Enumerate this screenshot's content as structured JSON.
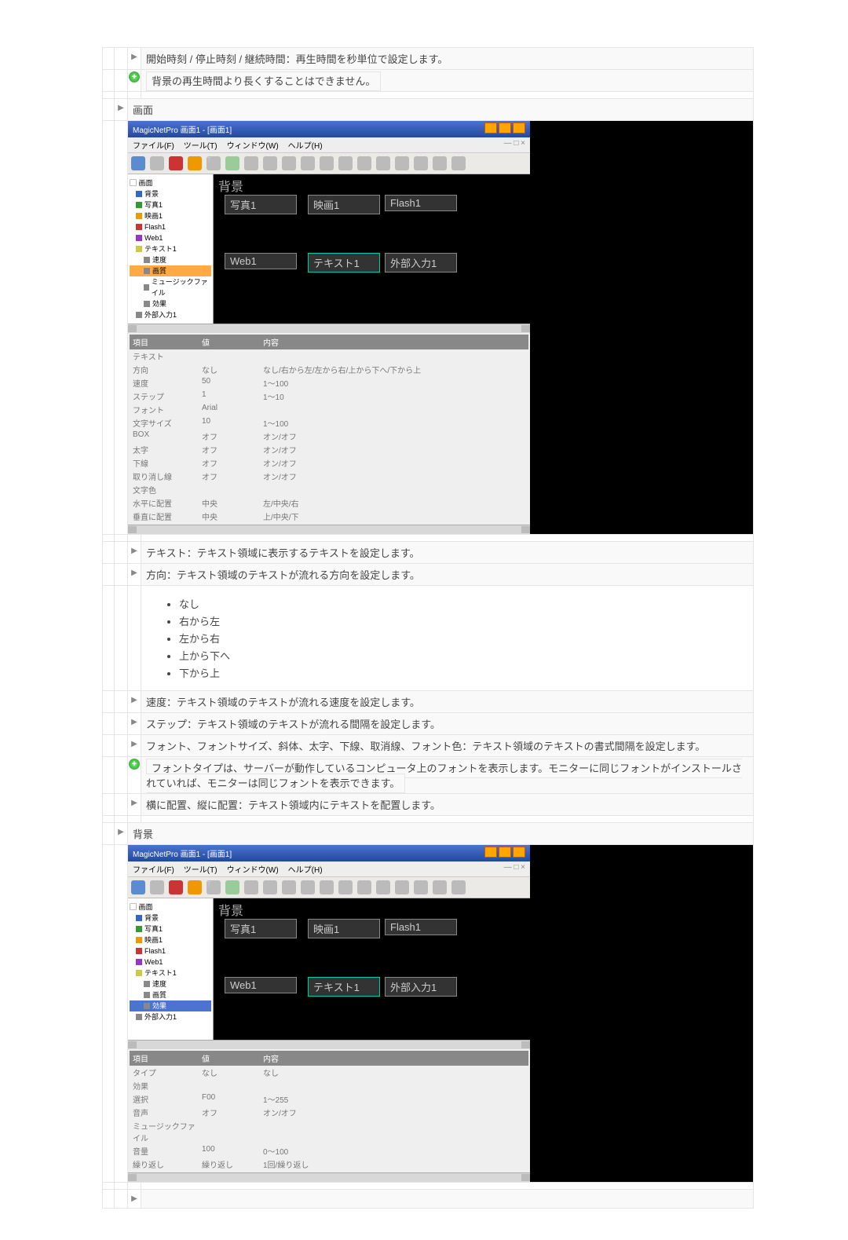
{
  "top": {
    "heading": "開始時刻 / 停止時刻 / 継続時間：再生時間を秒単位で設定します。",
    "note": "背景の再生時間より長くすることはできません。"
  },
  "section_screen_label": "画面",
  "app": {
    "title": "MagicNetPro 画面1 - [画面1]",
    "menu": [
      "ファイル(F)",
      "ツール(T)",
      "ウィンドウ(W)",
      "ヘルプ(H)"
    ],
    "tree_header": "画面",
    "tree1": [
      {
        "cls": "b",
        "label": "背景"
      },
      {
        "cls": "g",
        "label": "写真1"
      },
      {
        "cls": "o",
        "label": "映画1"
      },
      {
        "cls": "r",
        "label": "Flash1"
      },
      {
        "cls": "pu",
        "label": "Web1"
      },
      {
        "cls": "y",
        "label": "テキスト1",
        "children": [
          {
            "cls": "gr",
            "label": "速度"
          },
          {
            "cls": "gr",
            "label": "画質",
            "hl": "sel"
          },
          {
            "cls": "gr",
            "label": "ミュージックファイル"
          },
          {
            "cls": "gr",
            "label": "効果"
          }
        ]
      },
      {
        "cls": "gr",
        "label": "外部入力1"
      }
    ],
    "bg_label": "背景",
    "slots": [
      "写真1",
      "映画1",
      "Flash1",
      "Web1",
      "テキスト1",
      "外部入力1"
    ],
    "prop_header": [
      "項目",
      "値",
      "内容"
    ],
    "props1": [
      [
        "テキスト",
        "",
        ""
      ],
      [
        "方向",
        "なし",
        "なし/右から左/左から右/上から下へ/下から上"
      ],
      [
        "速度",
        "50",
        "1～100"
      ],
      [
        "ステップ",
        "1",
        "1～10"
      ],
      [
        "フォント",
        "Arial",
        ""
      ],
      [
        "文字サイズ",
        "10",
        "1～100"
      ],
      [
        "BOX",
        "オフ",
        "オン/オフ"
      ],
      [
        "太字",
        "オフ",
        "オン/オフ"
      ],
      [
        "下線",
        "オフ",
        "オン/オフ"
      ],
      [
        "取り消し線",
        "オフ",
        "オン/オフ"
      ],
      [
        "文字色",
        "",
        ""
      ],
      [
        "水平に配置",
        "中央",
        "左/中央/右"
      ],
      [
        "垂直に配置",
        "中央",
        "上/中央/下"
      ]
    ]
  },
  "text_item": "テキスト：テキスト領域に表示するテキストを設定します。",
  "dir_item": "方向：テキスト領域のテキストが流れる方向を設定します。",
  "dir_options": [
    "なし",
    "右から左",
    "左から右",
    "上から下へ",
    "下から上"
  ],
  "speed_item": "速度：テキスト領域のテキストが流れる速度を設定します。",
  "step_item": "ステップ：テキスト領域のテキストが流れる間隔を設定します。",
  "font_item": "フォント、フォントサイズ、斜体、太字、下線、取消線、フォント色：テキスト領域のテキストの書式間隔を設定します。",
  "font_note": "フォントタイプは、サーバーが動作しているコンピュータ上のフォントを表示します。モニターに同じフォントがインストールされていれば、モニターは同じフォントを表示できます。",
  "align_item": "横に配置、縦に配置：テキスト領域内にテキストを配置します。",
  "section_bg_label": "背景",
  "app2": {
    "tree": [
      {
        "cls": "b",
        "label": "背景"
      },
      {
        "cls": "g",
        "label": "写真1"
      },
      {
        "cls": "o",
        "label": "映画1"
      },
      {
        "cls": "r",
        "label": "Flash1"
      },
      {
        "cls": "pu",
        "label": "Web1"
      },
      {
        "cls": "y",
        "label": "テキスト1",
        "children": [
          {
            "cls": "gr",
            "label": "速度"
          },
          {
            "cls": "gr",
            "label": "画質"
          },
          {
            "cls": "gr",
            "label": "効果",
            "hl": "sel2"
          }
        ]
      },
      {
        "cls": "gr",
        "label": "外部入力1"
      }
    ],
    "props": [
      [
        "タイプ",
        "なし",
        "なし"
      ],
      [
        "効果",
        "",
        ""
      ],
      [
        "選択",
        "F00",
        "1～255"
      ],
      [
        "音声",
        "オフ",
        "オン/オフ"
      ],
      [
        "ミュージックファイル",
        "",
        ""
      ],
      [
        "音量",
        "100",
        "0～100"
      ],
      [
        "繰り返し",
        "繰り返し",
        "1回/繰り返し"
      ]
    ]
  }
}
